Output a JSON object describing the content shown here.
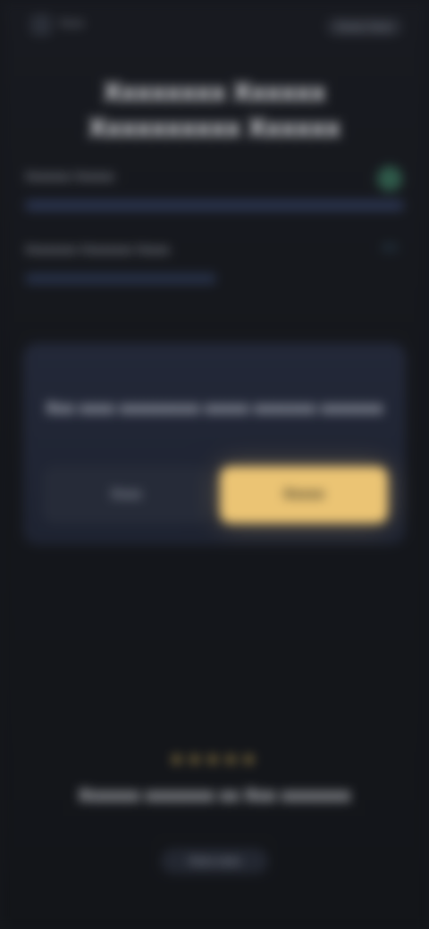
{
  "topbar": {
    "app_name": "Xxxx",
    "action_label": "Xxxxx Xxxx"
  },
  "title": "Xxxxxxxx Xxxxxx Xxxxxxxxxx Xxxxxx",
  "rows": [
    {
      "label": "Xxxxxxx Xxxxxx"
    },
    {
      "label": "Xxxxxxxx Xxxxxxxx Xxxxx"
    }
  ],
  "card": {
    "text": "Xxx xxxx xxxxxxxxx xxxxx xxxxxxx xxxxxxx",
    "secondary_label": "Xxxx",
    "primary_label": "Xxxxx"
  },
  "bottom": {
    "stars": "★★★★★",
    "title": "Xxxxxx xxxxxxx xx Xxx xxxxxxx",
    "link_label": "Xxxx xxxx"
  }
}
